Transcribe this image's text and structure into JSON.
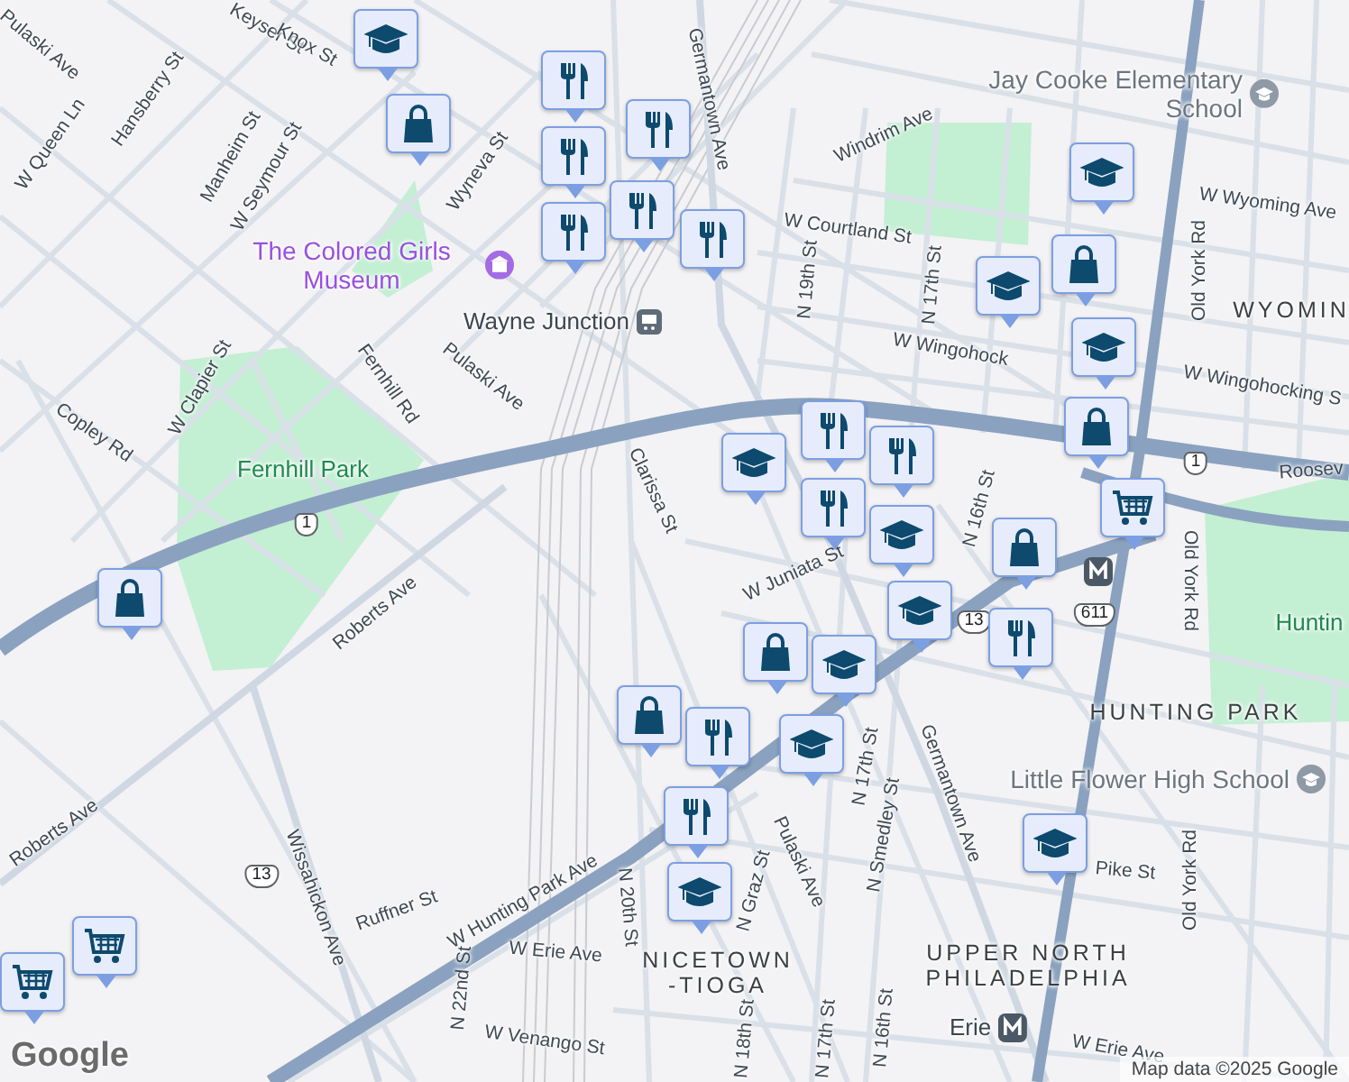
{
  "labels": [
    {
      "text": "Keyser St",
      "kind": "street"
    },
    {
      "text": "Knox St",
      "kind": "street"
    },
    {
      "text": "Pulaski Ave",
      "kind": "street"
    },
    {
      "text": "W Queen Ln",
      "kind": "street"
    },
    {
      "text": "Hansberry St",
      "kind": "street"
    },
    {
      "text": "Manheim St",
      "kind": "street"
    },
    {
      "text": "W Seymour St",
      "kind": "street"
    },
    {
      "text": "Wyneva St",
      "kind": "street"
    },
    {
      "text": "The Colored Girls Museum",
      "kind": "museum"
    },
    {
      "text": "Wayne Junction",
      "kind": "station"
    },
    {
      "text": "Fernhill Rd",
      "kind": "street"
    },
    {
      "text": "Pulaski Ave",
      "kind": "street"
    },
    {
      "text": "W Clapier St",
      "kind": "street"
    },
    {
      "text": "Copley Rd",
      "kind": "street"
    },
    {
      "text": "Fernhill Park",
      "kind": "park"
    },
    {
      "text": "Germantown Ave",
      "kind": "street"
    },
    {
      "text": "Clarissa St",
      "kind": "street"
    },
    {
      "text": "Windrim Ave",
      "kind": "street"
    },
    {
      "text": "Jay Cooke Elementary School",
      "kind": "school"
    },
    {
      "text": "W Wyoming Ave",
      "kind": "street"
    },
    {
      "text": "W Courtland St",
      "kind": "street"
    },
    {
      "text": "N 19th St",
      "kind": "street"
    },
    {
      "text": "N 17th St",
      "kind": "street"
    },
    {
      "text": "W Wingohock",
      "kind": "street"
    },
    {
      "text": "WYOMIN",
      "kind": "neighborhood"
    },
    {
      "text": "W Wingohocking S",
      "kind": "street"
    },
    {
      "text": "Old York Rd",
      "kind": "street"
    },
    {
      "text": "Roosev",
      "kind": "street"
    },
    {
      "text": "W Juniata St",
      "kind": "street"
    },
    {
      "text": "N 16th St",
      "kind": "street"
    },
    {
      "text": "Roberts Ave",
      "kind": "street"
    },
    {
      "text": "Roberts Ave",
      "kind": "street"
    },
    {
      "text": "Wissahickon Ave",
      "kind": "street"
    },
    {
      "text": "Ruffner St",
      "kind": "street"
    },
    {
      "text": "W Hunting Park Ave",
      "kind": "street"
    },
    {
      "text": "W Erie Ave",
      "kind": "street"
    },
    {
      "text": "N 22nd St",
      "kind": "street"
    },
    {
      "text": "N 20th St",
      "kind": "street"
    },
    {
      "text": "W Venango St",
      "kind": "street"
    },
    {
      "text": "NICETOWN -TIOGA",
      "kind": "neighborhood"
    },
    {
      "text": "Huntin",
      "kind": "park"
    },
    {
      "text": "HUNTING PARK",
      "kind": "neighborhood"
    },
    {
      "text": "Little Flower High School",
      "kind": "school"
    },
    {
      "text": "Old York Rd",
      "kind": "street"
    },
    {
      "text": "Old York Rd",
      "kind": "street"
    },
    {
      "text": "Germantown Ave",
      "kind": "street"
    },
    {
      "text": "N 17th St",
      "kind": "street"
    },
    {
      "text": "N Smedley St",
      "kind": "street"
    },
    {
      "text": "Pulaski Ave",
      "kind": "street"
    },
    {
      "text": "N Graz St",
      "kind": "street"
    },
    {
      "text": "Pike St",
      "kind": "street"
    },
    {
      "text": "UPPER NORTH PHILADELPHIA",
      "kind": "neighborhood"
    },
    {
      "text": "N 18th St",
      "kind": "street"
    },
    {
      "text": "N 17th St",
      "kind": "street"
    },
    {
      "text": "N 16th St",
      "kind": "street"
    },
    {
      "text": "Erie",
      "kind": "metro-station"
    },
    {
      "text": "W Erie Ave",
      "kind": "street"
    },
    {
      "text": "1",
      "kind": "shield"
    },
    {
      "text": "1",
      "kind": "shield"
    },
    {
      "text": "13",
      "kind": "shield"
    },
    {
      "text": "611",
      "kind": "shield"
    },
    {
      "text": "13",
      "kind": "shield"
    }
  ],
  "pins": [
    {
      "kind": "school"
    },
    {
      "kind": "shopping"
    },
    {
      "kind": "restaurant"
    },
    {
      "kind": "restaurant"
    },
    {
      "kind": "restaurant"
    },
    {
      "kind": "restaurant"
    },
    {
      "kind": "restaurant"
    },
    {
      "kind": "restaurant"
    },
    {
      "kind": "school"
    },
    {
      "kind": "school"
    },
    {
      "kind": "shopping"
    },
    {
      "kind": "school"
    },
    {
      "kind": "shopping"
    },
    {
      "kind": "restaurant"
    },
    {
      "kind": "school"
    },
    {
      "kind": "grocery"
    },
    {
      "kind": "restaurant"
    },
    {
      "kind": "restaurant"
    },
    {
      "kind": "school"
    },
    {
      "kind": "shopping"
    },
    {
      "kind": "shopping"
    },
    {
      "kind": "school"
    },
    {
      "kind": "restaurant"
    },
    {
      "kind": "shopping"
    },
    {
      "kind": "school"
    },
    {
      "kind": "restaurant"
    },
    {
      "kind": "shopping"
    },
    {
      "kind": "school"
    },
    {
      "kind": "restaurant"
    },
    {
      "kind": "school"
    },
    {
      "kind": "school"
    },
    {
      "kind": "grocery"
    },
    {
      "kind": "grocery"
    }
  ],
  "logo": "Google",
  "attribution": "Map data ©2025 Google"
}
